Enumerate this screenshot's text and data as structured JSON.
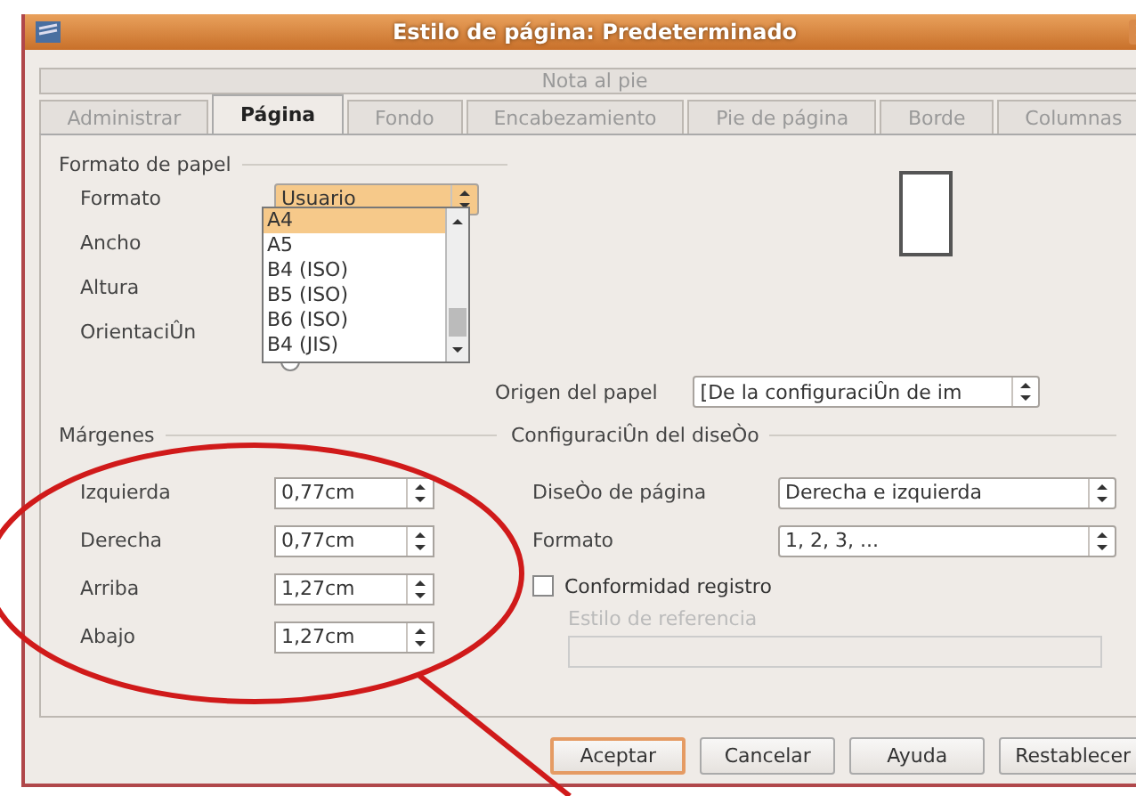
{
  "window": {
    "title": "Estilo de página: Predeterminado"
  },
  "tabs_top": [
    {
      "label": "Nota al pie",
      "selected": false
    }
  ],
  "tabs": [
    {
      "label": "Administrar",
      "selected": false
    },
    {
      "label": "Página",
      "selected": true
    },
    {
      "label": "Fondo",
      "selected": false
    },
    {
      "label": "Encabezamiento",
      "selected": false
    },
    {
      "label": "Pie de página",
      "selected": false
    },
    {
      "label": "Borde",
      "selected": false
    },
    {
      "label": "Columnas",
      "selected": false
    }
  ],
  "paper_format": {
    "heading": "Formato de papel",
    "format_label": "Formato",
    "format_value": "Usuario",
    "width_label": "Ancho",
    "height_label": "Altura",
    "orientation_label": "OrientaciÛn",
    "format_options": [
      {
        "label": "A4",
        "selected": true
      },
      {
        "label": "A5",
        "selected": false
      },
      {
        "label": "B4 (ISO)",
        "selected": false
      },
      {
        "label": "B5 (ISO)",
        "selected": false
      },
      {
        "label": "B6 (ISO)",
        "selected": false
      },
      {
        "label": "B4 (JIS)",
        "selected": false
      }
    ]
  },
  "paper_source": {
    "label": "Origen del papel",
    "value": "[De la configuraciÛn de im"
  },
  "margins": {
    "heading": "Márgenes",
    "fields": [
      {
        "label": "Izquierda",
        "value": "0,77cm"
      },
      {
        "label": "Derecha",
        "value": "0,77cm"
      },
      {
        "label": "Arriba",
        "value": "1,27cm"
      },
      {
        "label": "Abajo",
        "value": "1,27cm"
      }
    ]
  },
  "layout": {
    "heading": "ConfiguraciÛn del diseÒo",
    "page_layout_label": "DiseÒo de página",
    "page_layout_value": "Derecha e izquierda",
    "format_label": "Formato",
    "format_value": "1, 2, 3, ...",
    "register_label": "Conformidad registro",
    "register_checked": false,
    "reference_label": "Estilo de referencia",
    "reference_disabled": true
  },
  "buttons": [
    {
      "label": "Aceptar",
      "default": true
    },
    {
      "label": "Cancelar",
      "default": false
    },
    {
      "label": "Ayuda",
      "default": false
    },
    {
      "label": "Restablecer",
      "default": false
    }
  ]
}
